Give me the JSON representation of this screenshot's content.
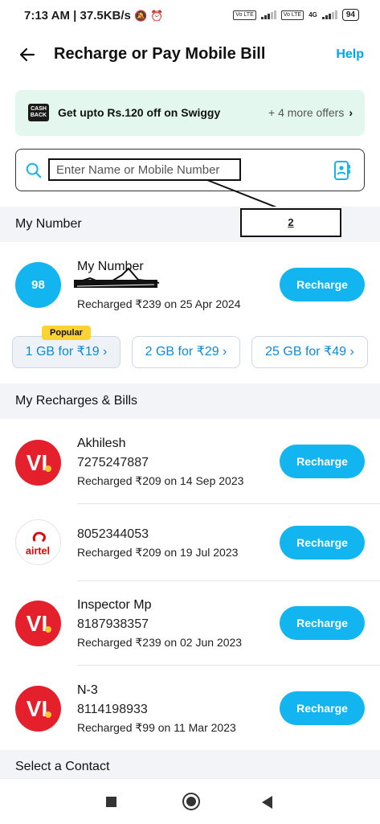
{
  "status_bar": {
    "time": "7:13 AM",
    "net_speed": "37.5KB/s",
    "volte1": "Vo LTE",
    "volte2": "Vo LTE",
    "net_type": "4G",
    "battery": "94"
  },
  "header": {
    "title": "Recharge or Pay Mobile Bill",
    "help": "Help"
  },
  "offer": {
    "icon_text": "CASH BACK",
    "text": "Get upto Rs.120 off on Swiggy",
    "more": "+ 4 more offers"
  },
  "search": {
    "placeholder": "Enter Name or Mobile Number"
  },
  "annotation": {
    "label": "2"
  },
  "my_number_section": {
    "title": "My Number",
    "avatar": "98",
    "name": "My Number",
    "recharged": "Recharged ₹239 on 25 Apr 2024",
    "button": "Recharge",
    "plans": [
      {
        "label": "1 GB for ₹19 ›",
        "badge": "Popular"
      },
      {
        "label": "2 GB for ₹29 ›"
      },
      {
        "label": "25 GB for ₹49 ›"
      }
    ]
  },
  "recharges_section": {
    "title": "My Recharges & Bills",
    "items": [
      {
        "operator": "vi",
        "name": "Akhilesh",
        "number": "7275247887",
        "recharged": "Recharged ₹209 on 14 Sep 2023",
        "button": "Recharge"
      },
      {
        "operator": "airtel",
        "name": "",
        "number": "8052344053",
        "recharged": "Recharged ₹209 on 19 Jul 2023",
        "button": "Recharge"
      },
      {
        "operator": "vi",
        "name": "Inspector Mp",
        "number": "8187938357",
        "recharged": "Recharged ₹239 on 02 Jun 2023",
        "button": "Recharge"
      },
      {
        "operator": "vi",
        "name": "N-3",
        "number": "8114198933",
        "recharged": "Recharged ₹99 on 11 Mar 2023",
        "button": "Recharge"
      }
    ]
  },
  "contact_section": {
    "title": "Select a Contact"
  },
  "colors": {
    "accent": "#12b5f0",
    "vi_red": "#e3202b",
    "vi_yellow": "#ffc531",
    "airtel_red": "#e40000",
    "offer_bg": "#e3f7ee"
  }
}
